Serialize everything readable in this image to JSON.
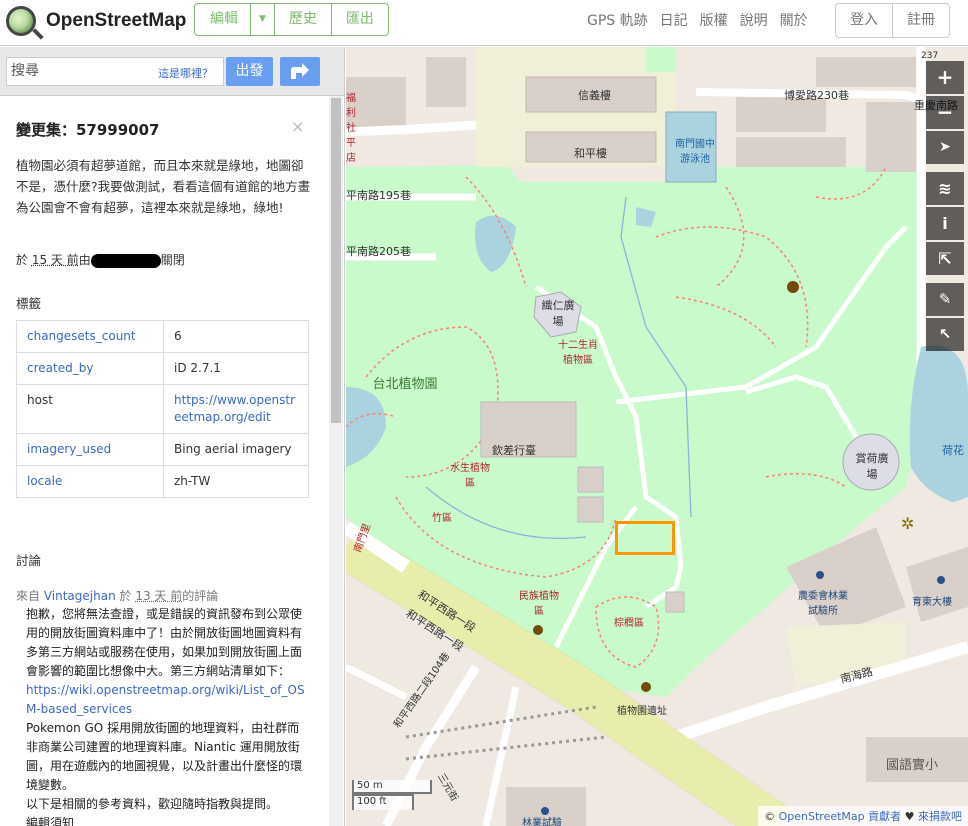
{
  "header": {
    "logo_text": "OpenStreetMap",
    "edit_label": "編輯",
    "history_label": "歷史",
    "export_label": "匯出",
    "nav": [
      "GPS 軌跡",
      "日記",
      "版權",
      "說明",
      "關於"
    ],
    "login_label": "登入",
    "signup_label": "註冊"
  },
  "search": {
    "placeholder": "搜尋",
    "where_label": "這是哪裡？",
    "go_label": "出發"
  },
  "changeset": {
    "title": "變更集：57999007",
    "close": "×",
    "comment": "植物園必須有超夢道館，而且本來就是綠地，地圖卻不是，憑什麼?我要做測試，看看這個有道館的地方畫為公園會不會有超夢，這裡本來就是綠地，綠地!",
    "closed_prefix": "於 ",
    "closed_time": "15 天 前",
    "closed_mid": "由",
    "closed_suffix": "關閉"
  },
  "tags": {
    "heading": "標籤",
    "rows": [
      {
        "key": "changesets_count",
        "value": "6"
      },
      {
        "key": "created_by",
        "value": "iD 2.7.1"
      },
      {
        "key": "host",
        "value": "https://www.openstreetmap.org/edit"
      },
      {
        "key": "imagery_used",
        "value": "Bing aerial imagery"
      },
      {
        "key": "locale",
        "value": "zh-TW"
      }
    ]
  },
  "discussion": {
    "heading": "討論",
    "meta_prefix": "來自 ",
    "author": "Vintagejhan",
    "meta_mid": " 於 ",
    "time": "13 天 前",
    "meta_suffix": "的評論",
    "p1": "抱歉，您將無法查證，或是錯誤的資訊發布到公眾使用的開放街圖資料庫中了！由於開放街圖地圖資料有多第三方網站或服務在使用，如果加到開放街圖上面會影響的範圍比想像中大。第三方網站清單如下：",
    "link1": "https://wiki.openstreetmap.org/wiki/List_of_OSM-based_services",
    "p2": "Pokemon GO 採用開放街圖的地理資料，由社群而非商業公司建置的地理資料庫。Niantic 運用開放街圖，用在遊戲內的地圖視覺，以及計畫出什麼怪的環境變數。",
    "p3": "以下是相關的參考資料，歡迎隨時指教與提問。",
    "p4": "編輯須知"
  },
  "map": {
    "labels": {
      "xinyi": "信義樓",
      "heping": "和平樓",
      "pool": "南門國中游泳池",
      "bopai": "博愛路230巷",
      "chongqing": "重慶南路",
      "ping195": "平南路195巷",
      "ping205": "平南路205巷",
      "weaving": "織仁廣場",
      "zodiac": "十二生肖植物區",
      "garden": "台北植物園",
      "qinchai": "欽差行臺",
      "aquatic": "水生植物區",
      "bamboo": "竹區",
      "lotusplaza": "賞荷廣場",
      "lotus": "荷花",
      "ethno": "民族植物區",
      "palm": "棕櫚區",
      "hpw1": "和平西路一段",
      "hpw2": "和平西路一段",
      "hpw104": "和平西路二段104巷",
      "nanhai": "南海路",
      "council": "農委會林業試驗所",
      "building": "育東大樓",
      "ruins": "植物園遺址",
      "mandarin": "國語實小",
      "sanyuan": "三元街",
      "forestry": "林業試驗",
      "gate": "南門里",
      "fuli": "福利社平店",
      "num": "237"
    },
    "controls": [
      "+",
      "−",
      "➤",
      "≋",
      "i",
      "⇱",
      "✎",
      "↖"
    ],
    "scale_m": "50 m",
    "scale_ft": "100 ft",
    "attrib_prefix": "© ",
    "attrib_osm": "OpenStreetMap 貢獻者",
    "attrib_heart": " ♥ ",
    "attrib_donate": "來捐款吧"
  }
}
